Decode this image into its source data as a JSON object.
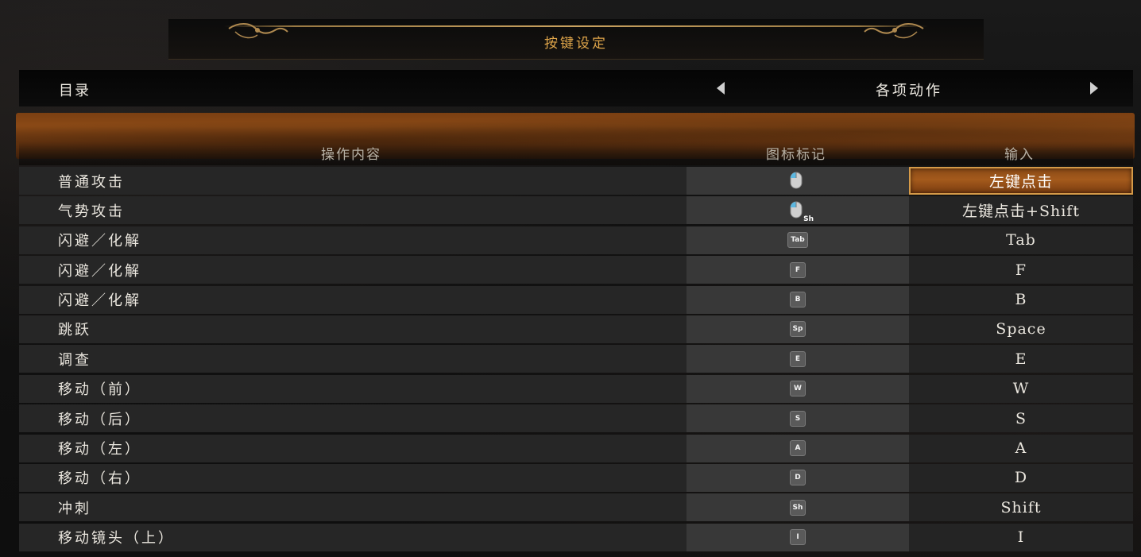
{
  "title": "按键设定",
  "category": {
    "label": "目录",
    "value": "各项动作"
  },
  "columns": {
    "action": "操作内容",
    "icon": "图标标记",
    "input": "输入"
  },
  "rows": [
    {
      "action": "普通攻击",
      "icon": "mouse-left-icon",
      "icon_text": "",
      "input": "左键点击",
      "selected": true
    },
    {
      "action": "气势攻击",
      "icon": "mouse-left-shift-icon",
      "icon_text": "Sh",
      "input": "左键点击+Shift"
    },
    {
      "action": "闪避／化解",
      "icon": "key-icon",
      "icon_text": "Tab",
      "input": "Tab"
    },
    {
      "action": "闪避／化解",
      "icon": "key-icon",
      "icon_text": "F",
      "input": "F"
    },
    {
      "action": "闪避／化解",
      "icon": "key-icon",
      "icon_text": "B",
      "input": "B"
    },
    {
      "action": "跳跃",
      "icon": "key-icon",
      "icon_text": "Sp",
      "input": "Space"
    },
    {
      "action": "调查",
      "icon": "key-icon",
      "icon_text": "E",
      "input": "E"
    },
    {
      "action": "移动（前）",
      "icon": "key-icon",
      "icon_text": "W",
      "input": "W"
    },
    {
      "action": "移动（后）",
      "icon": "key-icon",
      "icon_text": "S",
      "input": "S"
    },
    {
      "action": "移动（左）",
      "icon": "key-icon",
      "icon_text": "A",
      "input": "A"
    },
    {
      "action": "移动（右）",
      "icon": "key-icon",
      "icon_text": "D",
      "input": "D"
    },
    {
      "action": "冲刺",
      "icon": "key-icon",
      "icon_text": "Sh",
      "input": "Shift"
    },
    {
      "action": "移动镜头（上）",
      "icon": "key-icon",
      "icon_text": "I",
      "input": "I"
    }
  ],
  "colors": {
    "title_gold": "#e0a64a",
    "selected_orange": "#a45a1c",
    "header_orange": "#8c4a16"
  }
}
